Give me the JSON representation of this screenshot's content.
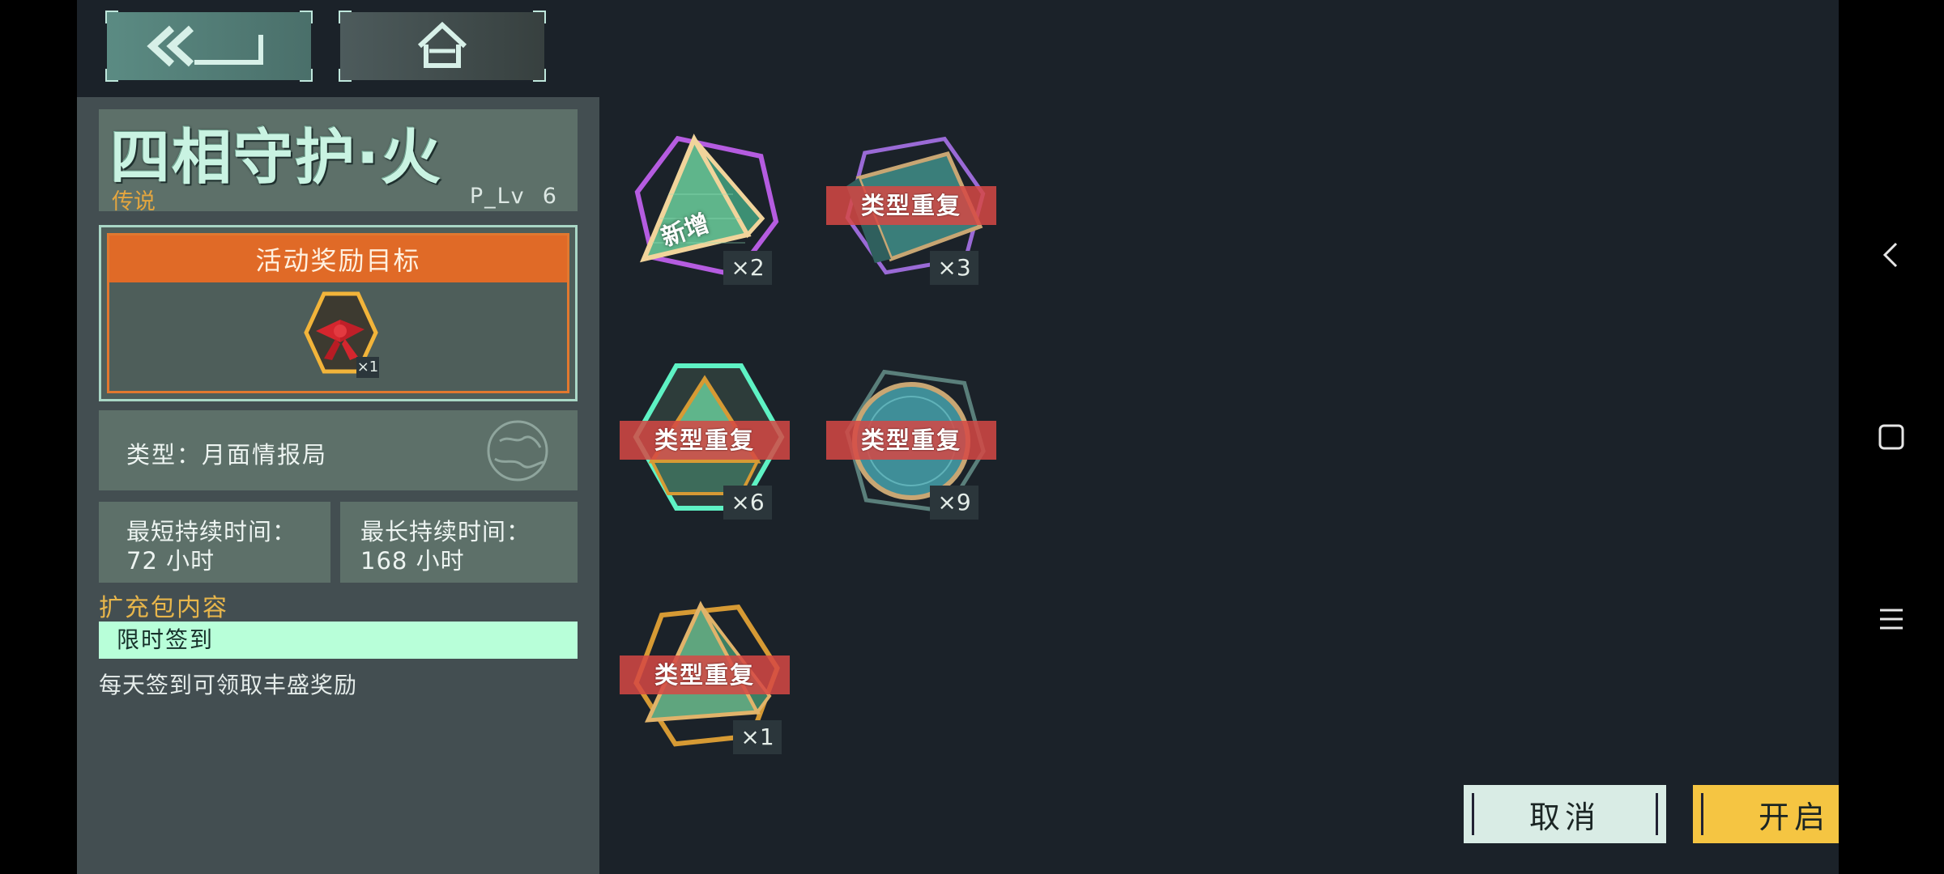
{
  "header": {
    "back_icon": "double-chevron-back-icon",
    "home_icon": "home-icon"
  },
  "pack": {
    "title": "四相守护·火",
    "rarity": "传说",
    "level": "P_Lv  6"
  },
  "reward": {
    "heading": "活动奖励目标",
    "item_count": "×1",
    "item_icon": "red-bow-gift-icon"
  },
  "type": {
    "label": "类型：月面情报局",
    "icon": "globe-icon"
  },
  "duration": {
    "min_label": "最短持续时间：",
    "min_value": "72 小时",
    "max_label": "最长持续时间：",
    "max_value": "168 小时"
  },
  "contents": {
    "section_title": "扩充包内容",
    "item_name": "限时签到",
    "item_desc": "每天签到可领取丰盛奖励"
  },
  "cards": [
    {
      "shape": "pyramid",
      "tag": "",
      "new_label": "新增",
      "count": "×2",
      "color": "#b55ce0"
    },
    {
      "shape": "flat",
      "tag": "类型重复",
      "new_label": "",
      "count": "×3",
      "color": "#9a6ad6"
    },
    {
      "shape": "hexagon",
      "tag": "类型重复",
      "new_label": "",
      "count": "×6",
      "color": "#5ef2c4"
    },
    {
      "shape": "circle",
      "tag": "类型重复",
      "new_label": "",
      "count": "×9",
      "color": "#4b9fa6"
    },
    {
      "shape": "pyramid",
      "tag": "类型重复",
      "new_label": "",
      "count": "×1",
      "color": "#d69a34"
    }
  ],
  "actions": {
    "cancel": "取消",
    "open": "开启"
  },
  "system_nav": {
    "back_icon": "chevron-left-icon",
    "home_icon": "square-icon",
    "menu_icon": "menu-icon"
  },
  "colors": {
    "background": "#1b2229",
    "panel": "#434e51",
    "card": "#5d7069",
    "accent_orange": "#e06a27",
    "accent_green": "#b8ffd9",
    "accent_yellow": "#f5c542"
  }
}
